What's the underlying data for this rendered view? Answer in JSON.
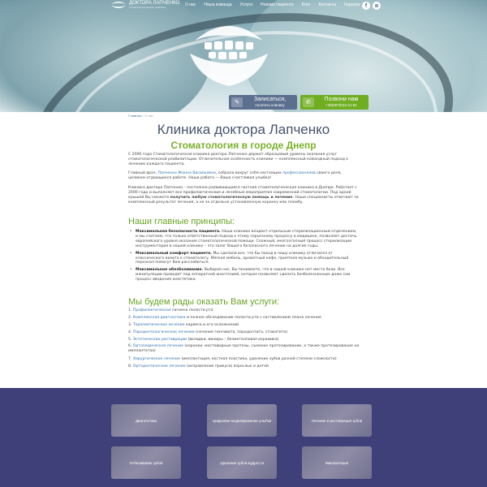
{
  "header": {
    "logo_title": "ДОКТОРА ЛАПЧЕНКО",
    "logo_subtitle": "стоматологическая клиника",
    "nav": [
      "О нас",
      "Наша команда",
      "Услуги",
      "Новому пациенту",
      "Блог",
      "Контакты",
      "Карьера"
    ],
    "social": [
      {
        "icon": "facebook-icon",
        "glyph": "f"
      },
      {
        "icon": "vk-icon",
        "glyph": "в"
      }
    ]
  },
  "hero": {
    "cta_signup_line1": "Записаться,",
    "cta_signup_line2": "посетить клинику",
    "cta_call_line1": "Позвони нам",
    "cta_call_line2": "+38(067)523-21-81",
    "colors": {
      "signup": "#5c6f8f",
      "call": "#6fad21"
    }
  },
  "breadcrumb": {
    "home": "Главная",
    "sep": "/",
    "current": "О нас"
  },
  "page": {
    "title": "Клиника доктора Лапченко",
    "subtitle": "Стоматология в городе Днепр",
    "p1": "С 2000 года Стоматологическая клиника доктора Лапченко держит образцовый уровень оказания услуг стоматологической реабилитации. Отличительная особенность клиники — комплексный командный подход к лечению каждого пациента.",
    "p2_a": "Главный врач, ",
    "p2_link1": "Лапченко Жанна Васильевна",
    "p2_b": ", собрала вокруг себя настоящих ",
    "p2_link2": "профессионалов",
    "p2_c": " своего дела, целиком отдающихся работе. Наша работа — Ваша счастливая улыбка!",
    "p3_a": "Клиника доктора Лапченко – постоянно развивающаяся частная стоматологическая клиника в Днепре. Работает с 2000 года и выполняет все профилактические и лечебные мероприятия современной стоматологии. Под одной крышей Вы сможете ",
    "p3_bold": "получить любую стоматологическую помощь и лечение",
    "p3_b": ". Наши специалисты отвечают за комплексный результат лечения, а не за отдельно установленную коронку или пломбу.",
    "principles_title": "Наши главные принципы:",
    "principles": [
      {
        "bold": "Максимальная безопасность пациента.",
        "text": " Наша клиника владеет отдельным стерилизационным отделением, и мы считаем, что только ответственный подход к этому серьезному процессу в медицине, позволяет достичь европейского уровня оказания стоматологической помощи. Сложный, многоэтапный процесс стерилизации инструментария в нашей клинике – это залог Вашего безопасного лечения на долгие годы."
      },
      {
        "bold": "Максимальный комфорт пациента.",
        "text": " Мы сделали все, что бы поход в нашу клинику отличался от классического визита к стоматологу. Мягкая мебель, ароматный кофе, приятная музыка и обходительный персонал помогут Вам расслабиться."
      },
      {
        "bold": "Максимальное обезболивание.",
        "text": " Выбирая нас, Вы понимаете, что в нашей клинике нет места боли. Все манипуляции проводят под аппаратной анестезией, которая позволяет сделать безболезненным даже сам процесс введения анестетика."
      }
    ],
    "services_title": "Мы будем рады оказать Вам услуги:",
    "services": [
      {
        "num": "1.",
        "link": "Профилактическая",
        "text": " гигиена полости рта"
      },
      {
        "num": "2.",
        "link": "Комплексная диагностика",
        "text": " и полное обследование полости рта с составлением плана лечения"
      },
      {
        "num": "3.",
        "link": "Терапевтическое лечение",
        "text": " кариеса и его осложнений"
      },
      {
        "num": "4.",
        "link": "Пародонтологическое лечение",
        "text": " (лечение гингивита, пародонтита, стоматита)"
      },
      {
        "num": "5.",
        "link": "Эстетические реставрации",
        "text": " (вкладки, виниры – безметалловая керамика)"
      },
      {
        "num": "6.",
        "link": "Ортопедическое лечение",
        "text": " (коронки, мостовидные протезы, съемное протезирование, а также протезирование на имплантатах)"
      },
      {
        "num": "7.",
        "link": "Хирургическое лечение",
        "text": " (имплантация, костная пластика, удаление зубов разной степени сложности)"
      },
      {
        "num": "8.",
        "link": "Ортодонтическое лечение",
        "text": " (исправление прикуса) взрослых и детей"
      }
    ]
  },
  "service_tiles": [
    "Диагностика",
    "Цифровое моделирование улыбки",
    "Лечение и реставрация зубов",
    "Отбеливание зубов",
    "Удаление зубов мудрости",
    "Имплантация"
  ],
  "colors": {
    "footer_bg": "#3f3f7a",
    "title": "#46536e",
    "green": "#7ab02b",
    "link": "#2f72b3"
  }
}
